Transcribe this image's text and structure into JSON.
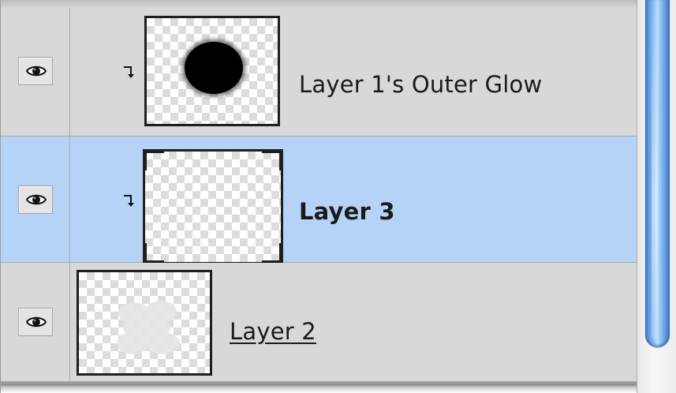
{
  "layers_panel": {
    "rows": [
      {
        "name": "Layer 1's Outer Glow",
        "visible_icon": "eye-icon",
        "clipped": true,
        "selected": false,
        "thumbnail": "black-blob"
      },
      {
        "name": "Layer 3",
        "visible_icon": "eye-icon",
        "clipped": true,
        "selected": true,
        "thumbnail": "transparent-with-mask"
      },
      {
        "name": "Layer 2",
        "visible_icon": "eye-icon",
        "clipped": false,
        "selected": false,
        "thumbnail": "faint-shape"
      }
    ]
  },
  "colors": {
    "panel_bg": "#d8d8d8",
    "selected_row_bg": "#b5d3f7",
    "scrollbar_accent": "#4a8ad8"
  }
}
